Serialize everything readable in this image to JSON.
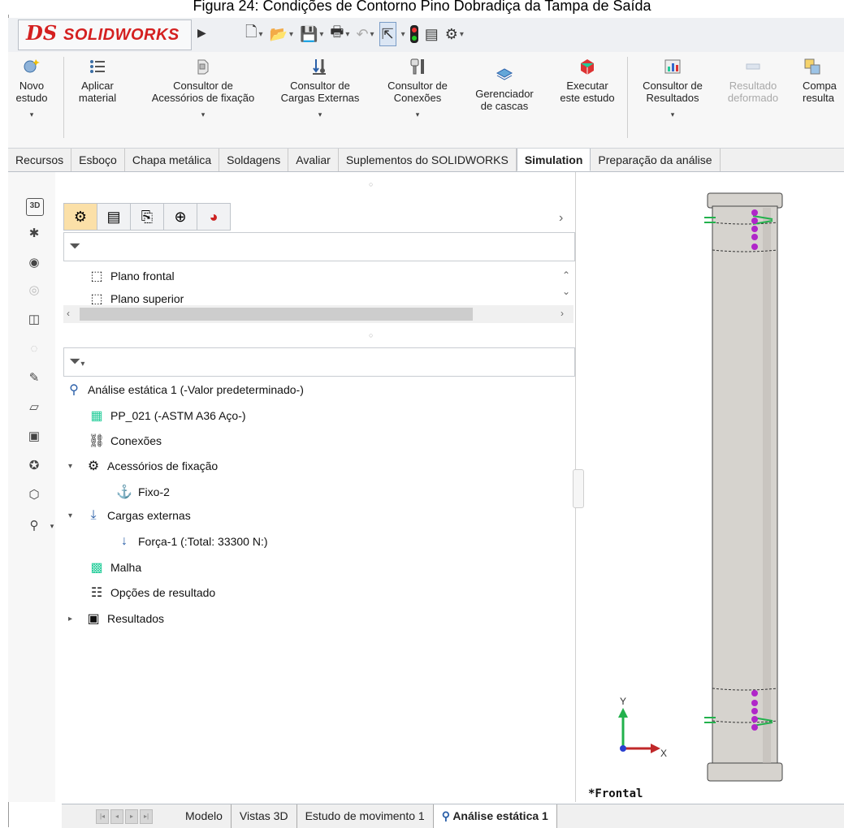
{
  "caption": "Figura 24: Condições de Contorno Pino Dobradiça da Tampa de Saída",
  "app": {
    "logo_ds": "DS",
    "logo_text": "SOLIDWORKS"
  },
  "ribbon": {
    "buttons": [
      {
        "label1": "Novo",
        "label2": "estudo",
        "icon": "new-study-icon"
      },
      {
        "label1": "Aplicar",
        "label2": "material",
        "icon": "apply-material-icon"
      },
      {
        "label1": "Consultor de",
        "label2": "Acessórios de fixação",
        "icon": "fixtures-advisor-icon"
      },
      {
        "label1": "Consultor de",
        "label2": "Cargas Externas",
        "icon": "external-loads-advisor-icon"
      },
      {
        "label1": "Consultor de",
        "label2": "Conexões",
        "icon": "connections-advisor-icon"
      },
      {
        "label1": "Gerenciador",
        "label2": "de cascas",
        "icon": "shell-manager-icon"
      },
      {
        "label1": "Executar",
        "label2": "este estudo",
        "icon": "run-study-icon"
      },
      {
        "label1": "Consultor de",
        "label2": "Resultados",
        "icon": "results-advisor-icon"
      },
      {
        "label1": "Resultado",
        "label2": "deformado",
        "icon": "deformed-result-icon"
      },
      {
        "label1": "Compa",
        "label2": "resulta",
        "icon": "compare-results-icon"
      }
    ]
  },
  "tabs": [
    "Recursos",
    "Esboço",
    "Chapa metálica",
    "Soldagens",
    "Avaliar",
    "Suplementos do SOLIDWORKS",
    "Simulation",
    "Preparação da análise"
  ],
  "active_tab": "Simulation",
  "feature_tree": {
    "items": [
      "Plano frontal",
      "Plano superior"
    ]
  },
  "study_tree": {
    "root": "Análise estática 1 (-Valor predeterminado-)",
    "part": "PP_021 (-ASTM A36 Aço-)",
    "connections": "Conexões",
    "fixtures": "Acessórios de fixação",
    "fixture_item": "Fixo-2",
    "loads": "Cargas externas",
    "load_item": "Força-1 (:Total: 33300 N:)",
    "mesh": "Malha",
    "result_options": "Opções de resultado",
    "results": "Resultados"
  },
  "viewport": {
    "view_label": "*Frontal",
    "axis_x": "X",
    "axis_y": "Y"
  },
  "bottom_tabs": [
    "Modelo",
    "Vistas 3D",
    "Estudo de movimento 1",
    "Análise estática 1"
  ],
  "active_bottom_tab": "Análise estática 1",
  "colors": {
    "brand": "#d42020",
    "fixture_marker": "#22b14c",
    "load_marker": "#b026c9",
    "part": "#d6d3ce"
  }
}
